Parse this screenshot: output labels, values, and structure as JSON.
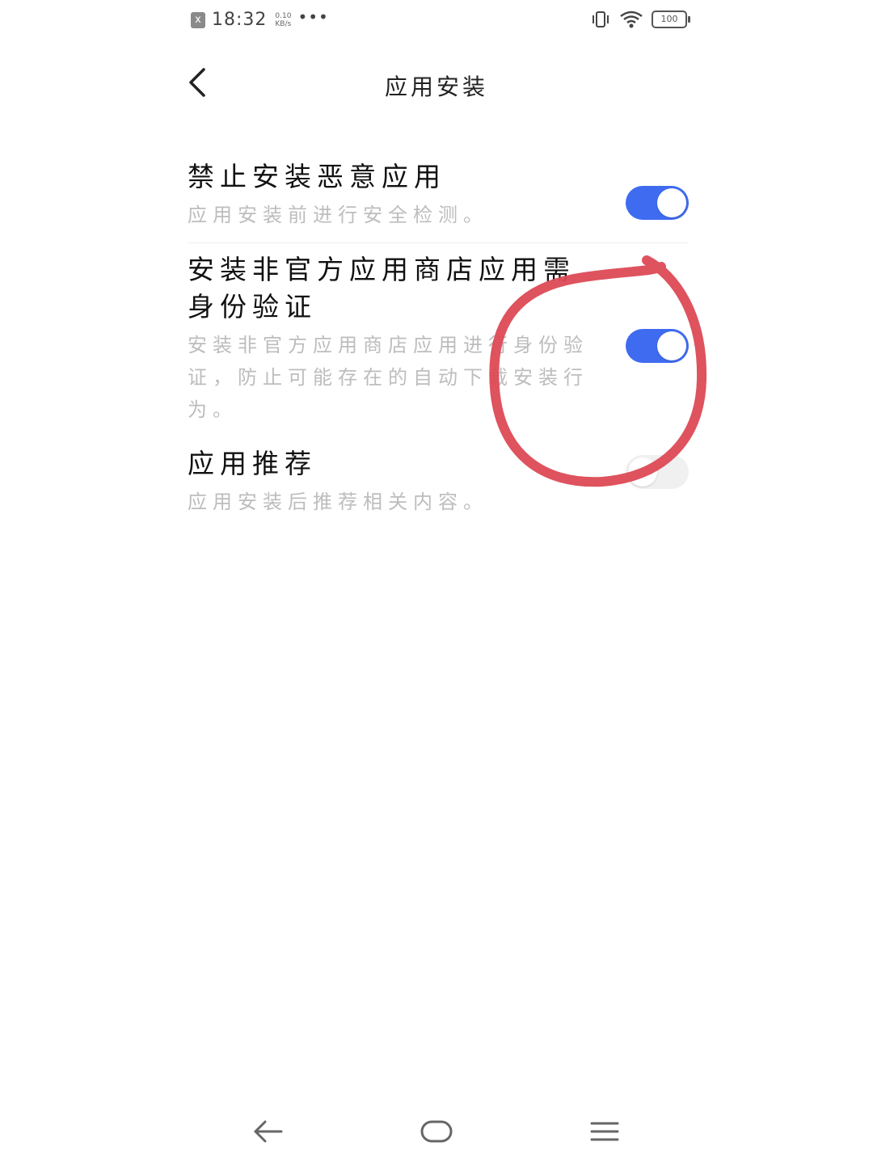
{
  "status_bar": {
    "time": "18:32",
    "speed_value": "0.10",
    "speed_unit": "KB/s",
    "more": "•••",
    "notification_icon": "x",
    "battery": "100"
  },
  "header": {
    "title": "应用安装",
    "back_icon": "chevron-left-icon"
  },
  "settings": [
    {
      "title": "禁止安装恶意应用",
      "subtitle": "应用安装前进行安全检测。",
      "enabled": true
    },
    {
      "title": "安装非官方应用商店应用需身份验证",
      "subtitle": "安装非官方应用商店应用进行身份验证，防止可能存在的自动下载安装行为。",
      "enabled": true
    },
    {
      "title": "应用推荐",
      "subtitle": "应用安装后推荐相关内容。",
      "enabled": false
    }
  ],
  "colors": {
    "toggle_on": "#3f6bf0",
    "toggle_off": "#f0f0f0",
    "annotation": "#dc4a55"
  },
  "nav_bar": {
    "back": "arrow-left-icon",
    "home": "home-icon",
    "recents": "menu-icon"
  }
}
